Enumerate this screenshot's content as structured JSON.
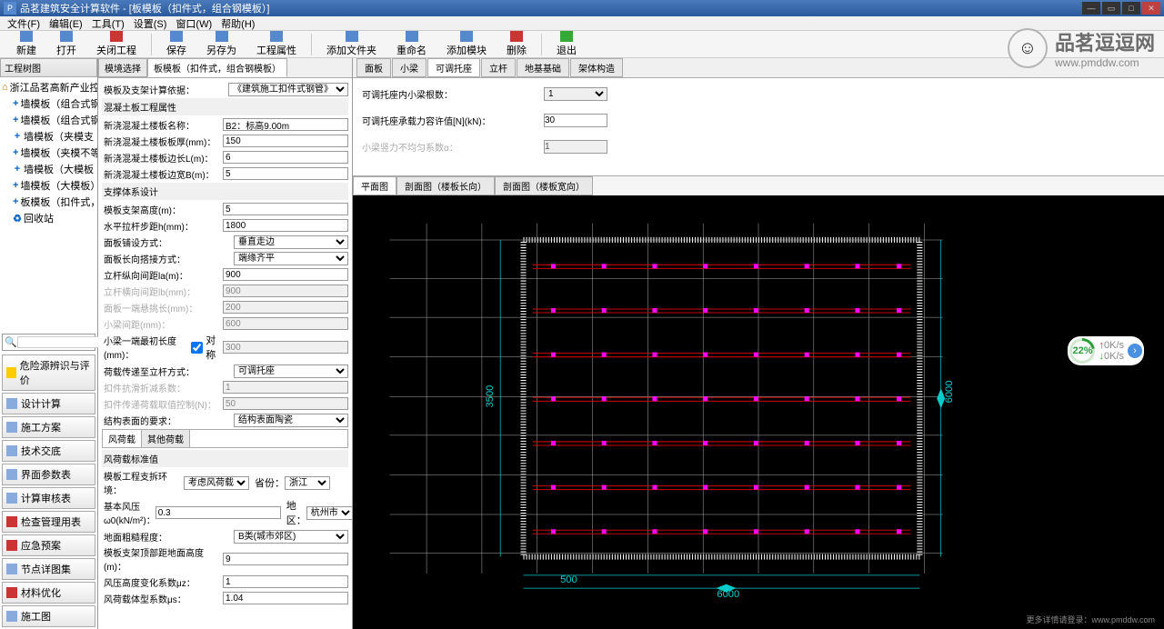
{
  "titlebar": {
    "title": "品茗建筑安全计算软件 - [板模板（扣件式，组合钢模板）]"
  },
  "menu": {
    "file": "文件(F)",
    "edit": "编辑(E)",
    "tool": "工具(T)",
    "settings": "设置(S)",
    "window": "窗口(W)",
    "help": "帮助(H)"
  },
  "toolbar": {
    "new": "新建",
    "open": "打开",
    "close_proj": "关闭工程",
    "save": "保存",
    "saveas": "另存为",
    "proj_prop": "工程属性",
    "add_files": "添加文件夹",
    "rename": "重命名",
    "add_module": "添加模块",
    "delete": "删除",
    "exit": "退出"
  },
  "left": {
    "tab": "工程树图",
    "root": "浙江品茗高新产业控",
    "items": [
      "墙模板（组合式钢",
      "墙模板（组合式钢",
      "墙模板（夹模支",
      "墙模板（夹模不等",
      "墙模板（大模板",
      "墙模板（大模板）",
      "板模板（扣件式，",
      "回收站"
    ],
    "btn_hazard": "危险源辨识与评价",
    "btns": [
      "设计计算",
      "施工方案",
      "技术交底",
      "界面参数表",
      "计算审核表",
      "检查管理用表",
      "应急预案",
      "节点详图集",
      "材料优化",
      "施工图"
    ]
  },
  "mid": {
    "tabs": [
      "模境选择",
      "板模板（扣件式，组合钢模板）"
    ],
    "sec1_title": "模板及支架计算依据：",
    "sec1_sel": "《建筑施工扣件式钢管》",
    "sec2_title": "混凝土板工程属性",
    "r_name_l": "新浇混凝土楼板名称：",
    "r_name": "B2：标高9.00m",
    "r_thk_l": "新浇混凝土楼板板厚(mm)：",
    "r_thk": "150",
    "r_len_l": "新浇混凝土楼板边长L(m)：",
    "r_len": "6",
    "r_wid_l": "新浇混凝土楼板边宽B(m)：",
    "r_wid": "5",
    "sec3_title": "支撑体系设计",
    "r_sh_l": "模板支架高度(m)：",
    "r_sh": "5",
    "r_step_l": "水平拉杆步距h(mm)：",
    "r_step": "1800",
    "r_pway_l": "面板铺设方式：",
    "r_pway": "垂直走边",
    "r_jway_l": "面板长向搭接方式：",
    "r_jway": "端缘齐平",
    "r_hspc_l": "立杆纵向间距la(m)：",
    "r_hspc": "900",
    "r_d1_l": "立杆横向间距lb(mm)：",
    "r_d1": "900",
    "r_d2_l": "面板一端悬挑长(mm)：",
    "r_d2": "200",
    "r_d3_l": "小梁间距(mm)：",
    "r_d3": "600",
    "r_over_l": "小梁一端最初长度(mm)：",
    "r_over_chk": "对称",
    "r_over": "300",
    "r_load_l": "荷载传递至立杆方式：",
    "r_load": "可调托座",
    "r_d4_l": "扣件抗滑折减系数：",
    "r_d4": "1",
    "r_d5_l": "扣件传递荷载取值控制(N)：",
    "r_d5": "50",
    "r_req_l": "结构表面的要求：",
    "r_req": "结构表面陶瓷",
    "wind_tabs": [
      "风荷载",
      "其他荷载"
    ],
    "wind_title": "风荷载标准值",
    "r_w1_l": "模板工程支拆环境：",
    "r_w1": "考虑风荷载",
    "r_prov_l": "省份：",
    "r_prov": "浙江",
    "r_w2_l": "基本风压ω0(kN/m²)：",
    "r_w2": "0.3",
    "r_city_l": "地区：",
    "r_city": "杭州市",
    "r_w3_l": "地面粗糙程度：",
    "r_w3": "B类(城市郊区)",
    "r_w4_l": "模板支架顶部距地面高度(m)：",
    "r_w4": "9",
    "r_w5_l": "风压高度变化系数μz：",
    "r_w5": "1",
    "r_w6_l": "风荷载体型系数μs：",
    "r_w6": "1.04"
  },
  "right": {
    "tabs": [
      "面板",
      "小梁",
      "可调托座",
      "立杆",
      "地基基础",
      "架体构造"
    ],
    "active": 2,
    "r1_l": "可调托座内小梁根数：",
    "r1": "1",
    "r2_l": "可调托座承载力容许值[N](kN)：",
    "r2": "30",
    "r3_l": "小梁竖力不均匀系数α：",
    "r3": "1"
  },
  "draw": {
    "tabs": [
      "平面图",
      "剖面图（楼板长向）",
      "剖面图（楼板宽向）"
    ],
    "dim_bottom_left": "500",
    "dim_bottom_total": "6000",
    "dim_left": "3500",
    "dim_right": "6000"
  },
  "watermark": {
    "cn": "品茗逗逗网",
    "url": "www.pmddw.com"
  },
  "progress": {
    "pct": "22%",
    "up": "0K/s",
    "down": "0K/s"
  },
  "footer": "更多详情请登录：www.pmddw.com"
}
